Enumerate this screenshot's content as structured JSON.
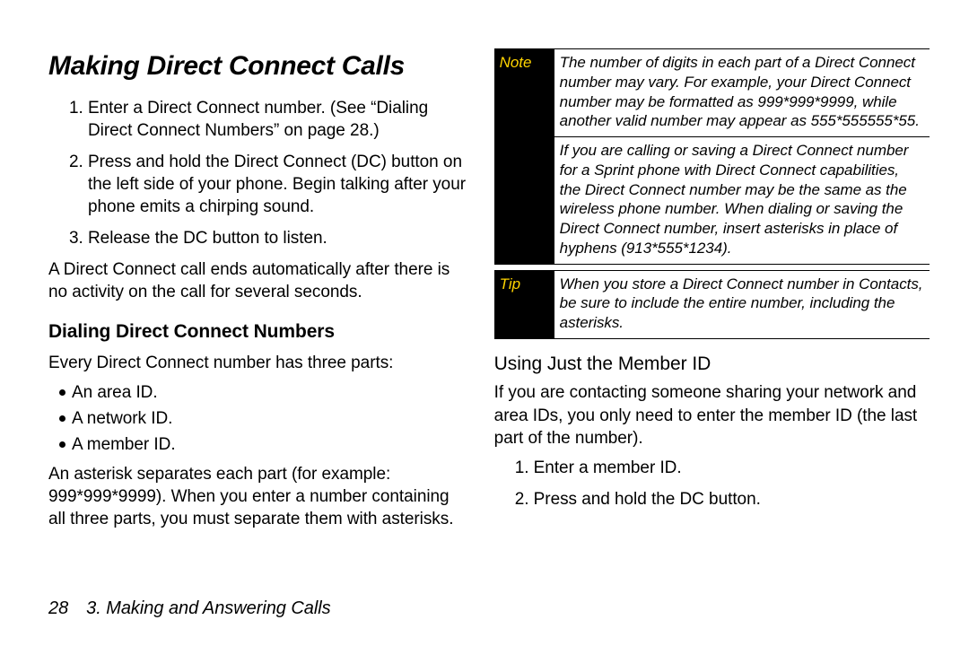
{
  "heading": "Making Direct Connect Calls",
  "steps": [
    "Enter a Direct Connect number. (See “Dialing Direct Connect Numbers” on page 28.)",
    "Press and hold the Direct Connect (DC) button on the left side of your phone. Begin talking after your phone emits a chirping sound.",
    "Release the DC button to listen."
  ],
  "after_steps": "A Direct Connect call ends automatically after there is no activity on the call for several seconds.",
  "dialing": {
    "heading": "Dialing Direct Connect Numbers",
    "intro": "Every Direct Connect number has three parts:",
    "parts": [
      "An area ID.",
      "A network ID.",
      "A member ID."
    ],
    "after": "An asterisk separates each part (for example: 999*999*9999). When you enter a number containing all three parts, you must separate them with asterisks."
  },
  "note_label": "Note",
  "note_rows": [
    "The number of digits in each part of a Direct Connect number may vary. For example, your Direct Connect number may be formatted as 999*999*9999, while another valid number may appear as 555*555555*55.",
    "If you are calling or saving a Direct Connect number for a Sprint phone with Direct Connect capabilities, the Direct Connect number may be the same as the wireless phone number. When dialing or saving the Direct Connect number, insert asterisks in place of hyphens (913*555*1234)."
  ],
  "tip_label": "Tip",
  "tip_text": "When you store a Direct Connect number in Contacts, be sure to include the entire number, including the asterisks.",
  "member": {
    "heading": "Using Just the Member ID",
    "intro": "If you are contacting someone sharing your network and area IDs, you only need to enter the member ID (the last part of the number).",
    "steps": [
      "Enter a member ID.",
      "Press and hold the DC button."
    ]
  },
  "footer": {
    "page": "28",
    "chapter": "3. Making and Answering Calls"
  }
}
